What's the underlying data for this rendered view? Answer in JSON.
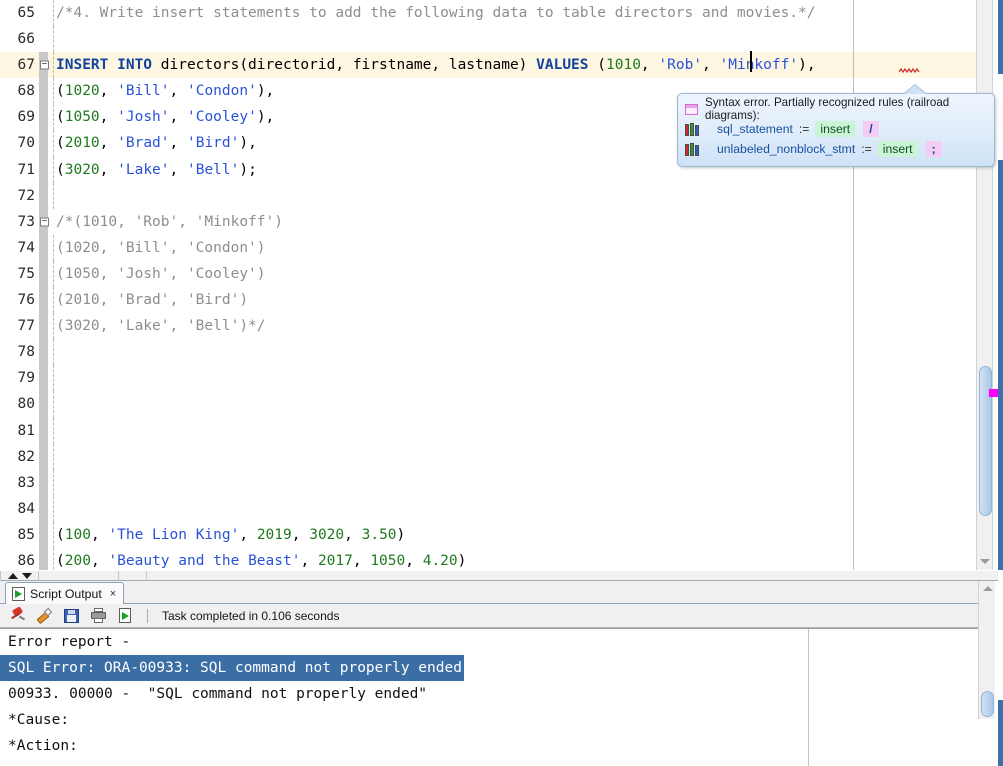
{
  "editor": {
    "first_line_number": 65,
    "current_line_number": 67,
    "caret_line": 67,
    "colors": {
      "keyword": "#13439e",
      "number": "#1e7a1e",
      "string": "#2a52d8",
      "comment": "#8e8e8e",
      "current_line_bg": "#fdf6e0",
      "error_marker": "#ff00ff"
    },
    "lines": [
      {
        "n": 65,
        "fold": false,
        "current": false,
        "tokens": [
          {
            "t": "/*4. Write insert statements to add the following data to table directors and movies.*/",
            "c": "cmt"
          }
        ]
      },
      {
        "n": 66,
        "fold": false,
        "current": false,
        "tokens": []
      },
      {
        "n": 67,
        "fold": true,
        "current": true,
        "tokens": [
          {
            "t": "INSERT INTO",
            "c": "kw"
          },
          {
            "t": " directors(directorid, firstname, lastname) ",
            "c": "pln"
          },
          {
            "t": "VALUES",
            "c": "kw"
          },
          {
            "t": " (",
            "c": "pln"
          },
          {
            "t": "1010",
            "c": "num"
          },
          {
            "t": ", ",
            "c": "pln"
          },
          {
            "t": "'Rob'",
            "c": "str"
          },
          {
            "t": ", ",
            "c": "pln"
          },
          {
            "t": "'Minkoff'",
            "c": "str"
          },
          {
            "t": "),",
            "c": "pln"
          }
        ]
      },
      {
        "n": 68,
        "fold": false,
        "current": false,
        "tokens": [
          {
            "t": "(",
            "c": "pln"
          },
          {
            "t": "1020",
            "c": "num"
          },
          {
            "t": ", ",
            "c": "pln"
          },
          {
            "t": "'Bill'",
            "c": "str"
          },
          {
            "t": ", ",
            "c": "pln"
          },
          {
            "t": "'Condon'",
            "c": "str"
          },
          {
            "t": "),",
            "c": "pln"
          }
        ]
      },
      {
        "n": 69,
        "fold": false,
        "current": false,
        "tokens": [
          {
            "t": "(",
            "c": "pln"
          },
          {
            "t": "1050",
            "c": "num"
          },
          {
            "t": ", ",
            "c": "pln"
          },
          {
            "t": "'Josh'",
            "c": "str"
          },
          {
            "t": ", ",
            "c": "pln"
          },
          {
            "t": "'Cooley'",
            "c": "str"
          },
          {
            "t": "),",
            "c": "pln"
          }
        ]
      },
      {
        "n": 70,
        "fold": false,
        "current": false,
        "tokens": [
          {
            "t": "(",
            "c": "pln"
          },
          {
            "t": "2010",
            "c": "num"
          },
          {
            "t": ", ",
            "c": "pln"
          },
          {
            "t": "'Brad'",
            "c": "str"
          },
          {
            "t": ", ",
            "c": "pln"
          },
          {
            "t": "'Bird'",
            "c": "str"
          },
          {
            "t": "),",
            "c": "pln"
          }
        ]
      },
      {
        "n": 71,
        "fold": false,
        "current": false,
        "tokens": [
          {
            "t": "(",
            "c": "pln"
          },
          {
            "t": "3020",
            "c": "num"
          },
          {
            "t": ", ",
            "c": "pln"
          },
          {
            "t": "'Lake'",
            "c": "str"
          },
          {
            "t": ", ",
            "c": "pln"
          },
          {
            "t": "'Bell'",
            "c": "str"
          },
          {
            "t": ");",
            "c": "pln"
          }
        ]
      },
      {
        "n": 72,
        "fold": false,
        "current": false,
        "tokens": []
      },
      {
        "n": 73,
        "fold": true,
        "current": false,
        "noindent": true,
        "tokens": [
          {
            "t": "/*(1010, 'Rob', 'Minkoff')",
            "c": "cmt"
          }
        ]
      },
      {
        "n": 74,
        "fold": false,
        "current": false,
        "tokens": [
          {
            "t": "(1020, 'Bill', 'Condon')",
            "c": "cmt"
          }
        ]
      },
      {
        "n": 75,
        "fold": false,
        "current": false,
        "tokens": [
          {
            "t": "(1050, 'Josh', 'Cooley')",
            "c": "cmt"
          }
        ]
      },
      {
        "n": 76,
        "fold": false,
        "current": false,
        "tokens": [
          {
            "t": "(2010, 'Brad', 'Bird')",
            "c": "cmt"
          }
        ]
      },
      {
        "n": 77,
        "fold": false,
        "current": false,
        "tokens": [
          {
            "t": "(3020, 'Lake', 'Bell')*/",
            "c": "cmt"
          }
        ]
      },
      {
        "n": 78,
        "fold": false,
        "current": false,
        "tokens": []
      },
      {
        "n": 79,
        "fold": false,
        "current": false,
        "tokens": []
      },
      {
        "n": 80,
        "fold": false,
        "current": false,
        "tokens": []
      },
      {
        "n": 81,
        "fold": false,
        "current": false,
        "tokens": []
      },
      {
        "n": 82,
        "fold": false,
        "current": false,
        "tokens": []
      },
      {
        "n": 83,
        "fold": false,
        "current": false,
        "tokens": []
      },
      {
        "n": 84,
        "fold": false,
        "current": false,
        "tokens": []
      },
      {
        "n": 85,
        "fold": false,
        "current": false,
        "tokens": [
          {
            "t": "(",
            "c": "pln"
          },
          {
            "t": "100",
            "c": "num"
          },
          {
            "t": ", ",
            "c": "pln"
          },
          {
            "t": "'The Lion King'",
            "c": "str"
          },
          {
            "t": ", ",
            "c": "pln"
          },
          {
            "t": "2019",
            "c": "num"
          },
          {
            "t": ", ",
            "c": "pln"
          },
          {
            "t": "3020",
            "c": "num"
          },
          {
            "t": ", ",
            "c": "pln"
          },
          {
            "t": "3.50",
            "c": "num"
          },
          {
            "t": ")",
            "c": "pln"
          }
        ]
      },
      {
        "n": 86,
        "fold": false,
        "current": false,
        "tokens": [
          {
            "t": "(",
            "c": "pln"
          },
          {
            "t": "200",
            "c": "num"
          },
          {
            "t": ", ",
            "c": "pln"
          },
          {
            "t": "'Beauty and the Beast'",
            "c": "str"
          },
          {
            "t": ", ",
            "c": "pln"
          },
          {
            "t": "2017",
            "c": "num"
          },
          {
            "t": ", ",
            "c": "pln"
          },
          {
            "t": "1050",
            "c": "num"
          },
          {
            "t": ", ",
            "c": "pln"
          },
          {
            "t": "4.20",
            "c": "num"
          },
          {
            "t": ")",
            "c": "pln"
          }
        ]
      }
    ]
  },
  "tooltip": {
    "icon": "window-pink-icon",
    "header": "Syntax error. Partially recognized rules (railroad diagrams):",
    "rules": [
      {
        "icon": "books-icon",
        "name": "sql_statement",
        "assign": ":=",
        "token": "insert",
        "terminator": "/"
      },
      {
        "icon": "books-icon",
        "name": "unlabeled_nonblock_stmt",
        "assign": ":=",
        "token": "insert",
        "terminator": ";"
      }
    ]
  },
  "splitter": {
    "up_icon": "triangle-up-icon",
    "down_icon": "triangle-down-icon"
  },
  "output": {
    "tab": {
      "icon": "script-output-icon",
      "label": "Script Output",
      "close": "×"
    },
    "toolbar": {
      "icons": [
        "pin-icon",
        "eraser-icon",
        "save-icon",
        "print-icon",
        "run-script-icon"
      ],
      "status": "Task completed in 0.106 seconds"
    },
    "lines": [
      {
        "text": "Error report -",
        "selected": false
      },
      {
        "text": "SQL Error: ORA-00933: SQL command not properly ended",
        "selected": true
      },
      {
        "text": "00933. 00000 -  \"SQL command not properly ended\"",
        "selected": false
      },
      {
        "text": "*Cause:",
        "selected": false
      },
      {
        "text": "*Action:",
        "selected": false
      }
    ]
  }
}
